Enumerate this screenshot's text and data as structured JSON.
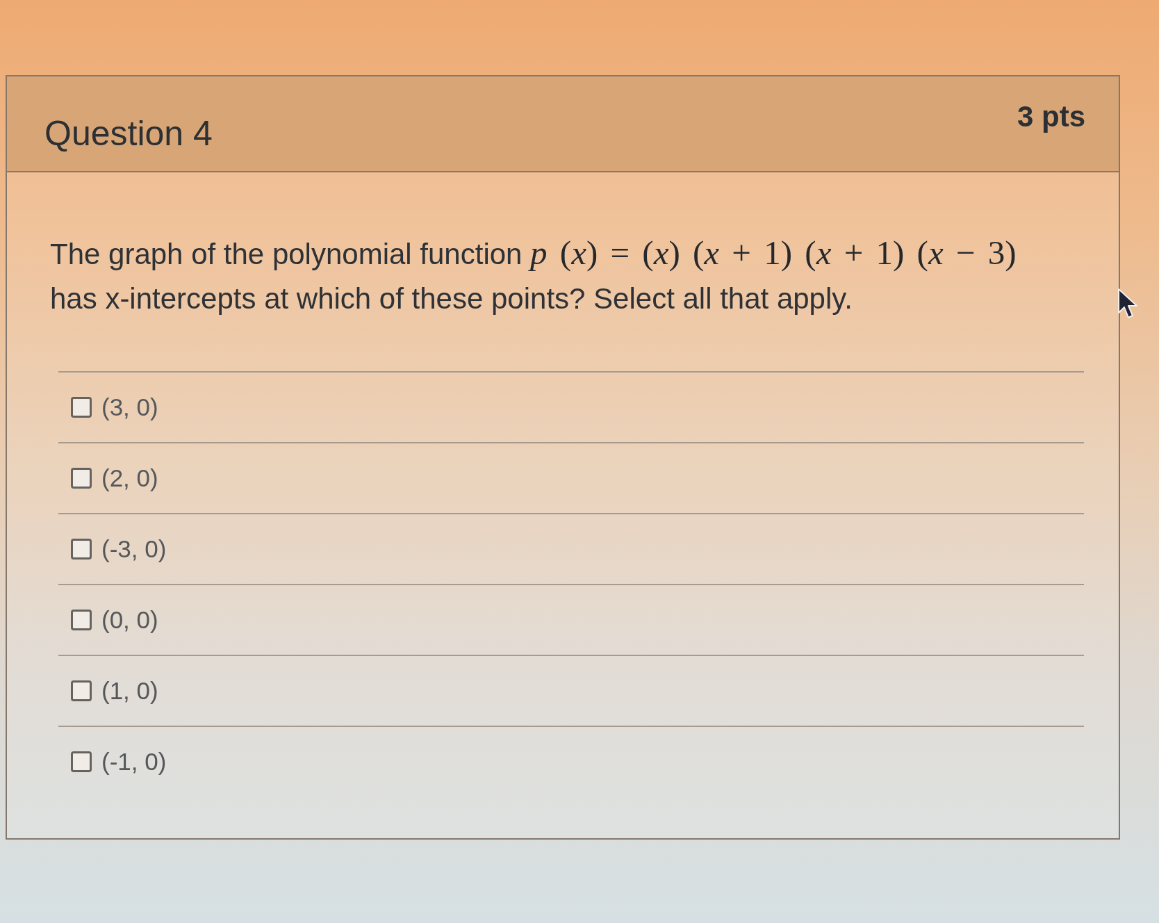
{
  "question": {
    "title": "Question 4",
    "points": "3 pts",
    "intro": "The graph of the polynomial function",
    "formula": "*p* (*x*) = (*x*) (*x* + 1) (*x* + 1) (*x* − 3)",
    "prompt": "has x-intercepts at which of these points? Select all that apply."
  },
  "options": [
    {
      "label": "(3, 0)",
      "checked": false
    },
    {
      "label": "(2, 0)",
      "checked": false
    },
    {
      "label": "(-3, 0)",
      "checked": false
    },
    {
      "label": "(0, 0)",
      "checked": false
    },
    {
      "label": "(1, 0)",
      "checked": false
    },
    {
      "label": "(-1, 0)",
      "checked": false
    }
  ]
}
